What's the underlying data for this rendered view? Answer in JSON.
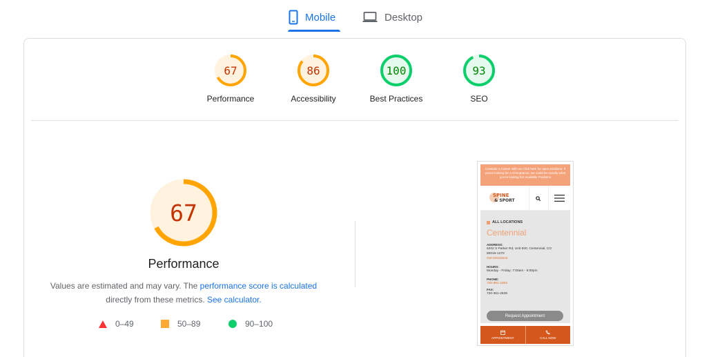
{
  "tabs": [
    {
      "label": "Mobile",
      "active": true,
      "icon": "smartphone-icon"
    },
    {
      "label": "Desktop",
      "active": false,
      "icon": "laptop-icon"
    }
  ],
  "scores": [
    {
      "label": "Performance",
      "value": "67",
      "status": "average"
    },
    {
      "label": "Accessibility",
      "value": "86",
      "status": "average"
    },
    {
      "label": "Best Practices",
      "value": "100",
      "status": "pass"
    },
    {
      "label": "SEO",
      "value": "93",
      "status": "pass"
    }
  ],
  "main": {
    "score": "67",
    "title": "Performance",
    "desc_prefix": "Values are estimated and may vary. The ",
    "desc_link": "performance score is calculated",
    "desc_mid": "directly from these metrics. ",
    "desc_link2": "See calculator."
  },
  "legend": [
    {
      "label": "0–49",
      "shape": "triangle",
      "color": "#ff3333"
    },
    {
      "label": "50–89",
      "shape": "square",
      "color": "#ffaa33"
    },
    {
      "label": "90–100",
      "shape": "circle",
      "color": "#0cce6b"
    }
  ],
  "colors": {
    "accent": "#1a73e8",
    "average_stroke": "#ffa400",
    "average_fill": "#fff3e0",
    "average_text": "#c33300",
    "pass_stroke": "#0cce6b",
    "pass_fill": "#e6f9ee",
    "pass_text": "#008800"
  },
  "phone": {
    "banner": "Consider a Career with us! Click here for open positions. If you're looking for a Chiropractor, we could be exactly what you're looking for! Available Positions",
    "logo_line1": "SPINE",
    "logo_line2": "& SPORT",
    "location_label": "ALL LOCATIONS",
    "city": "Centennial",
    "address_label": "ADDRESS:",
    "address_line1": "6202 S Parker Rd, Unit 500, Centennial, CO",
    "address_line2": "80016-1270",
    "directions": "Get Directions",
    "hours_label": "HOURS:",
    "hours": "Monday - Friday: 7:00am - 6:00pm",
    "phone_label": "PHONE:",
    "phone": "720-361-2304",
    "fax_label": "FAX:",
    "fax": "720-361-2639",
    "button": "Request Appointment",
    "bottom_left": "APPOINTMENT",
    "bottom_right": "CALL NOW"
  }
}
